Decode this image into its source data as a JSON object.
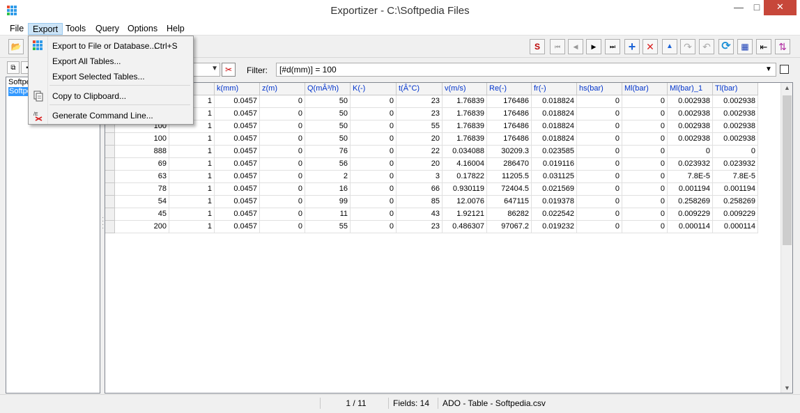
{
  "window": {
    "title": "Exportizer - C:\\Softpedia Files",
    "controls": {
      "minimize": "—",
      "maximize": "□",
      "close": "✕"
    }
  },
  "menu": [
    "File",
    "Export",
    "Tools",
    "Query",
    "Options",
    "Help"
  ],
  "export_menu": {
    "items": [
      {
        "label": "Export to File or Database...",
        "shortcut": "Ctrl+S",
        "icon": "grid-export-icon"
      },
      {
        "label": "Export All Tables...",
        "shortcut": "",
        "icon": ""
      },
      {
        "label": "Export Selected Tables...",
        "shortcut": "",
        "icon": ""
      },
      {
        "label": "Copy to Clipboard...",
        "shortcut": "",
        "icon": "clipboard-icon"
      },
      {
        "label": "Generate Command Line...",
        "shortcut": "",
        "icon": "command-line-icon"
      }
    ]
  },
  "toolbar": {
    "nav": {
      "sql": "S",
      "first": "⏮",
      "prior": "◀",
      "next": "▶",
      "last": "⏭",
      "insert": "+",
      "delete": "✕",
      "post": "▲",
      "redo": "↷",
      "undo": "↶",
      "refresh": "⟳",
      "columns": "▦",
      "fit": "⇤",
      "sort": "⇅"
    },
    "open": "📂"
  },
  "filter": {
    "label": "Filter:",
    "value": "[#d(mm)] = 100"
  },
  "tree": {
    "items": [
      {
        "label": "Softpe",
        "selected": false
      },
      {
        "label": "Softpe",
        "selected": true
      }
    ]
  },
  "grid": {
    "columns": [
      "",
      "k(mm)",
      "z(m)",
      "Q(mÂ³/h)",
      "K(-)",
      "t(Â°C)",
      "v(m/s)",
      "Re(-)",
      "fr(-)",
      "hs(bar)",
      "Ml(bar)",
      "Ml(bar)_1",
      "Tl(bar)"
    ],
    "rows": [
      [
        "",
        "1",
        "0.0457",
        "0",
        "50",
        "0",
        "23",
        "1.76839",
        "176486",
        "0.018824",
        "0",
        "0",
        "0.002938",
        "0.002938"
      ],
      [
        "",
        "1",
        "0.0457",
        "0",
        "50",
        "0",
        "23",
        "1.76839",
        "176486",
        "0.018824",
        "0",
        "0",
        "0.002938",
        "0.002938"
      ],
      [
        "100",
        "1",
        "0.0457",
        "0",
        "50",
        "0",
        "55",
        "1.76839",
        "176486",
        "0.018824",
        "0",
        "0",
        "0.002938",
        "0.002938"
      ],
      [
        "100",
        "1",
        "0.0457",
        "0",
        "50",
        "0",
        "20",
        "1.76839",
        "176486",
        "0.018824",
        "0",
        "0",
        "0.002938",
        "0.002938"
      ],
      [
        "888",
        "1",
        "0.0457",
        "0",
        "76",
        "0",
        "22",
        "0.034088",
        "30209.3",
        "0.023585",
        "0",
        "0",
        "0",
        "0"
      ],
      [
        "69",
        "1",
        "0.0457",
        "0",
        "56",
        "0",
        "20",
        "4.16004",
        "286470",
        "0.019116",
        "0",
        "0",
        "0.023932",
        "0.023932"
      ],
      [
        "63",
        "1",
        "0.0457",
        "0",
        "2",
        "0",
        "3",
        "0.17822",
        "11205.5",
        "0.031125",
        "0",
        "0",
        "7.8E-5",
        "7.8E-5"
      ],
      [
        "78",
        "1",
        "0.0457",
        "0",
        "16",
        "0",
        "66",
        "0.930119",
        "72404.5",
        "0.021569",
        "0",
        "0",
        "0.001194",
        "0.001194"
      ],
      [
        "54",
        "1",
        "0.0457",
        "0",
        "99",
        "0",
        "85",
        "12.0076",
        "647115",
        "0.019378",
        "0",
        "0",
        "0.258269",
        "0.258269"
      ],
      [
        "45",
        "1",
        "0.0457",
        "0",
        "11",
        "0",
        "43",
        "1.92121",
        "86282",
        "0.022542",
        "0",
        "0",
        "0.009229",
        "0.009229"
      ],
      [
        "200",
        "1",
        "0.0457",
        "0",
        "55",
        "0",
        "23",
        "0.486307",
        "97067.2",
        "0.019232",
        "0",
        "0",
        "0.000114",
        "0.000114"
      ]
    ]
  },
  "status": {
    "record": "1 / 11",
    "fields": "Fields: 14",
    "source": "ADO - Table - Softpedia.csv"
  },
  "colors": {
    "menu_active": "#cce4f7",
    "header_text": "#0033cc",
    "tree_selected": "#3399ff",
    "close_button": "#c7473a"
  }
}
